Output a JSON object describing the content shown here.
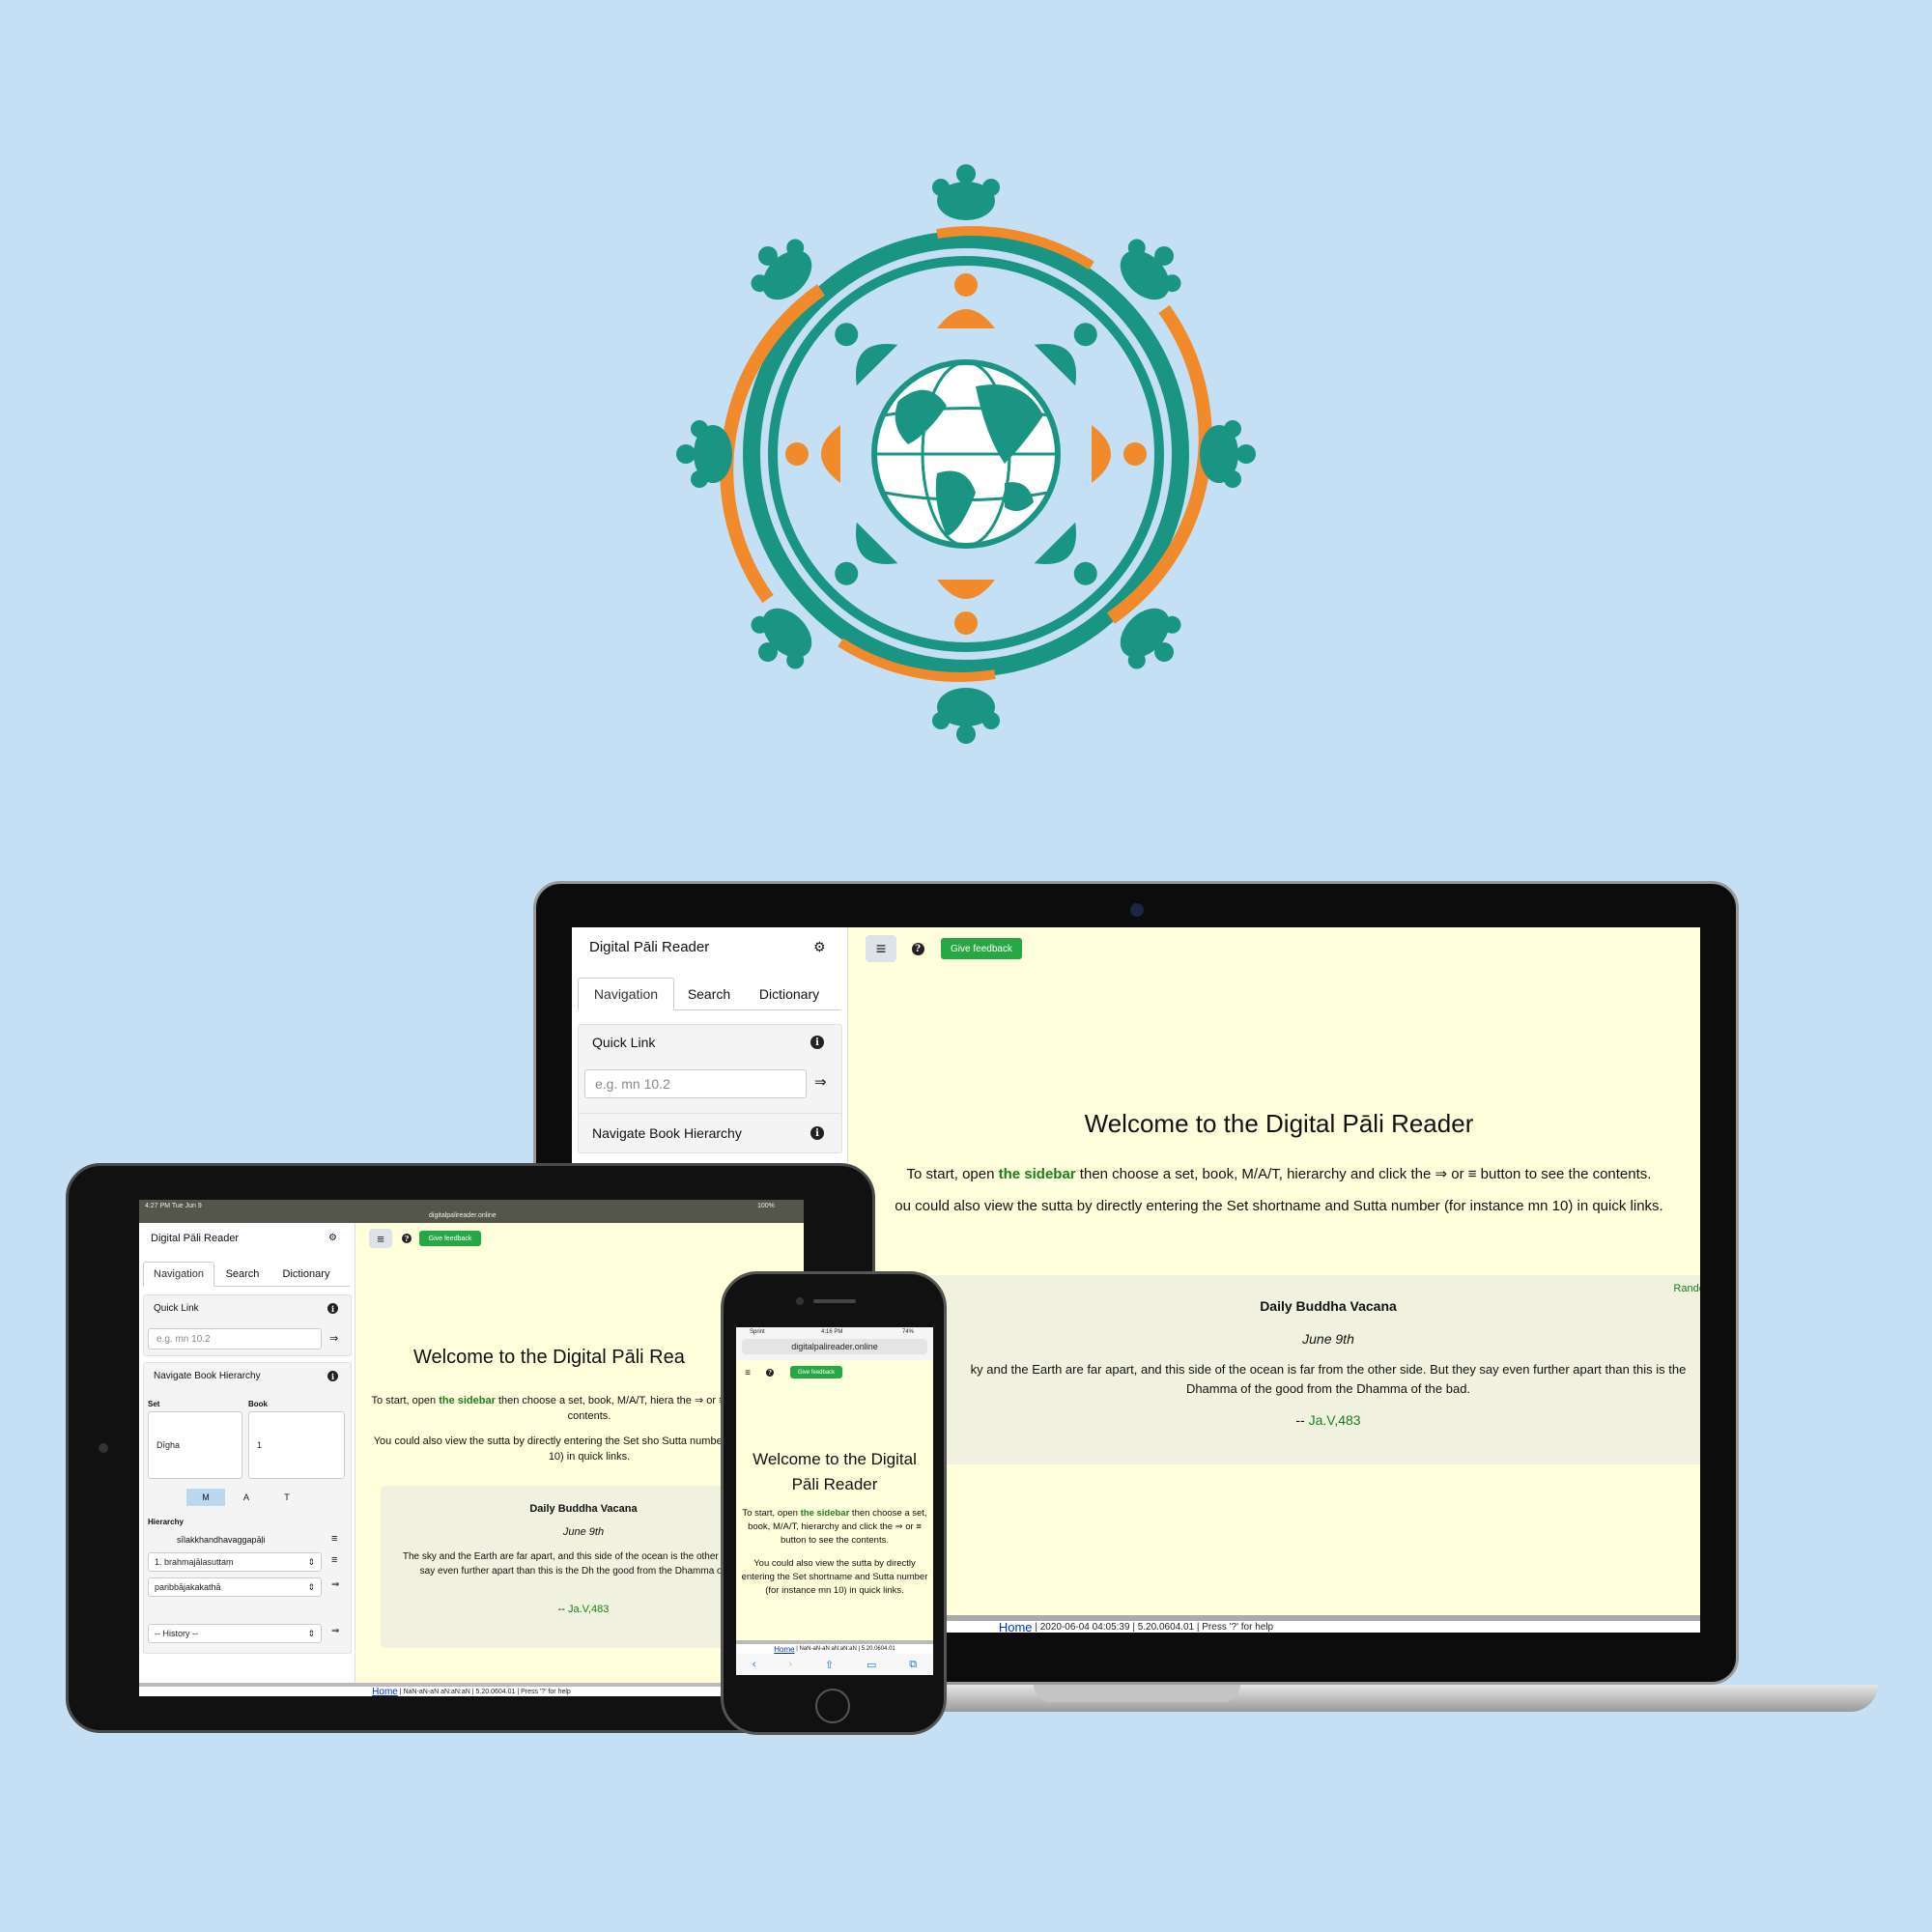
{
  "colors": {
    "background": "#c5e0f5",
    "teal": "#1a9583",
    "orange": "#f08a2a",
    "reader_bg": "#ffffdc",
    "card_bg": "#f1f1df",
    "feedback_green": "#28a745",
    "link_green": "#1b7e1b"
  },
  "app": {
    "title": "Digital Pāli Reader",
    "settings_icon": "gear-icon",
    "menu_icon": "hamburger-icon",
    "help_icon": "question-icon",
    "menu_glyph": "≡",
    "help_glyph": "?",
    "gear_glyph": "⚙",
    "arrow_glyph": "⇒",
    "feedback_label": "Give feedback",
    "tabs": [
      "Navigation",
      "Search",
      "Dictionary"
    ],
    "quick_link": {
      "label": "Quick Link",
      "placeholder": "e.g. mn 10.2",
      "info_glyph": "i"
    },
    "navigate": {
      "label": "Navigate Book Hierarchy",
      "set_label": "Set",
      "book_label": "Book",
      "set_value": "Dīgha",
      "book_value": "1",
      "mat": [
        "M",
        "A",
        "T"
      ],
      "hierarchy_label": "Hierarchy",
      "hierarchy_items": [
        "sīlakkhandhavaggapāḷi",
        "1. brahmajālasuttaṃ",
        "paribbājakakathā"
      ],
      "history": "-- History --"
    },
    "welcome": {
      "heading_laptop": "Welcome to the Digital Pāli Reader",
      "heading_tablet": "Welcome to the Digital Pāli Rea",
      "heading_phone": "Welcome to the Digital Pāli Reader",
      "p1_pre": "To start, open ",
      "p1_link": "the sidebar",
      "p1_post": " then choose a set, book, M/A/T, hierarchy and click the ⇒ or ≡ button to see the contents.",
      "p1_post_laptop": " then choose a set, book, M/A/T, hierarchy and click the ⇒ or ≡ button to see the contents.",
      "p2": "You could also view the sutta by directly entering the Set shortname and Sutta number (for instance mn 10) in quick links.",
      "p2_laptop": "ou could also view the sutta by directly entering the Set shortname and Sutta number (for instance mn 10) in quick links.",
      "p1_tablet_pre": "To start, open ",
      "p1_tablet_post": " then choose a set, book, M/A/T, hiera the ⇒ or ≡ button to see the contents.",
      "p2_tablet": "You could also view the sutta by directly entering the Set sho Sutta number (for instance mn 10) in quick links."
    },
    "vacana": {
      "random": "Random",
      "title": "Daily Buddha Vacana",
      "date": "June 9th",
      "text_laptop": "ky and the Earth are far apart, and this side of the ocean is far from the other side.  But they say even further apart than this is the Dhamma of the good from the Dhamma of the bad.",
      "text_tablet": "The sky and the Earth are far apart, and this side of the ocean is the other side.  But they say even further apart than this is the Dh the good from the Dhamma of the bad.",
      "source_prefix": "-- ",
      "source": "Ja.V,483"
    },
    "status_laptop": {
      "home": "Home",
      "date": "2020-06-04 04:05:39",
      "version": "5.20.0604.01",
      "help": "Press '?' for help"
    },
    "status_tablet": {
      "home": "Home",
      "date": "NaN-aN-aN aN:aN:aN",
      "version": "5.20.0604.01",
      "help": "Press '?' for help"
    },
    "status_phone": {
      "home": "Home",
      "date": "NaN-aN-aN aN:aN:aN",
      "version": "5.20.0604.01"
    }
  },
  "tablet_os": {
    "time": "4:27 PM  Tue Jun 9",
    "url": "digitalpalireader.online",
    "battery": "100%"
  },
  "phone_os": {
    "carrier": "Sprint",
    "time": "4:16 PM",
    "battery": "74%",
    "url": "digitalpalireader.online"
  }
}
